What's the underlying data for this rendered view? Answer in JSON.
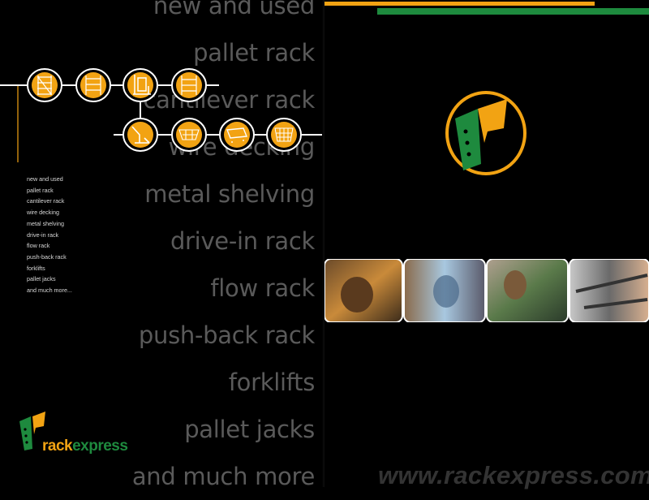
{
  "products_big": [
    "new and used",
    "pallet rack",
    "cantilever rack",
    "wire decking",
    "metal shelving",
    "drive-in rack",
    "flow rack",
    "push-back rack",
    "forklifts",
    "pallet jacks",
    "and much more"
  ],
  "products_small": [
    "new and used",
    "pallet rack",
    "cantilever rack",
    "wire decking",
    "metal shelving",
    "drive-in rack",
    "flow rack",
    "push-back rack",
    "forklifts",
    "pallet jacks",
    "and much more..."
  ],
  "brand": {
    "part1": "rack",
    "part2": "express"
  },
  "website": "www.rackexpress.com",
  "colors": {
    "orange": "#f2a313",
    "green": "#1e8a3e",
    "text_grey": "#5a5a5a"
  },
  "icons": [
    "pallet-rack-icon",
    "shelving-icon",
    "forklift-icon",
    "cantilever-icon",
    "pallet-jack-icon",
    "wire-decking-icon",
    "cart-icon",
    "wire-basket-icon"
  ]
}
